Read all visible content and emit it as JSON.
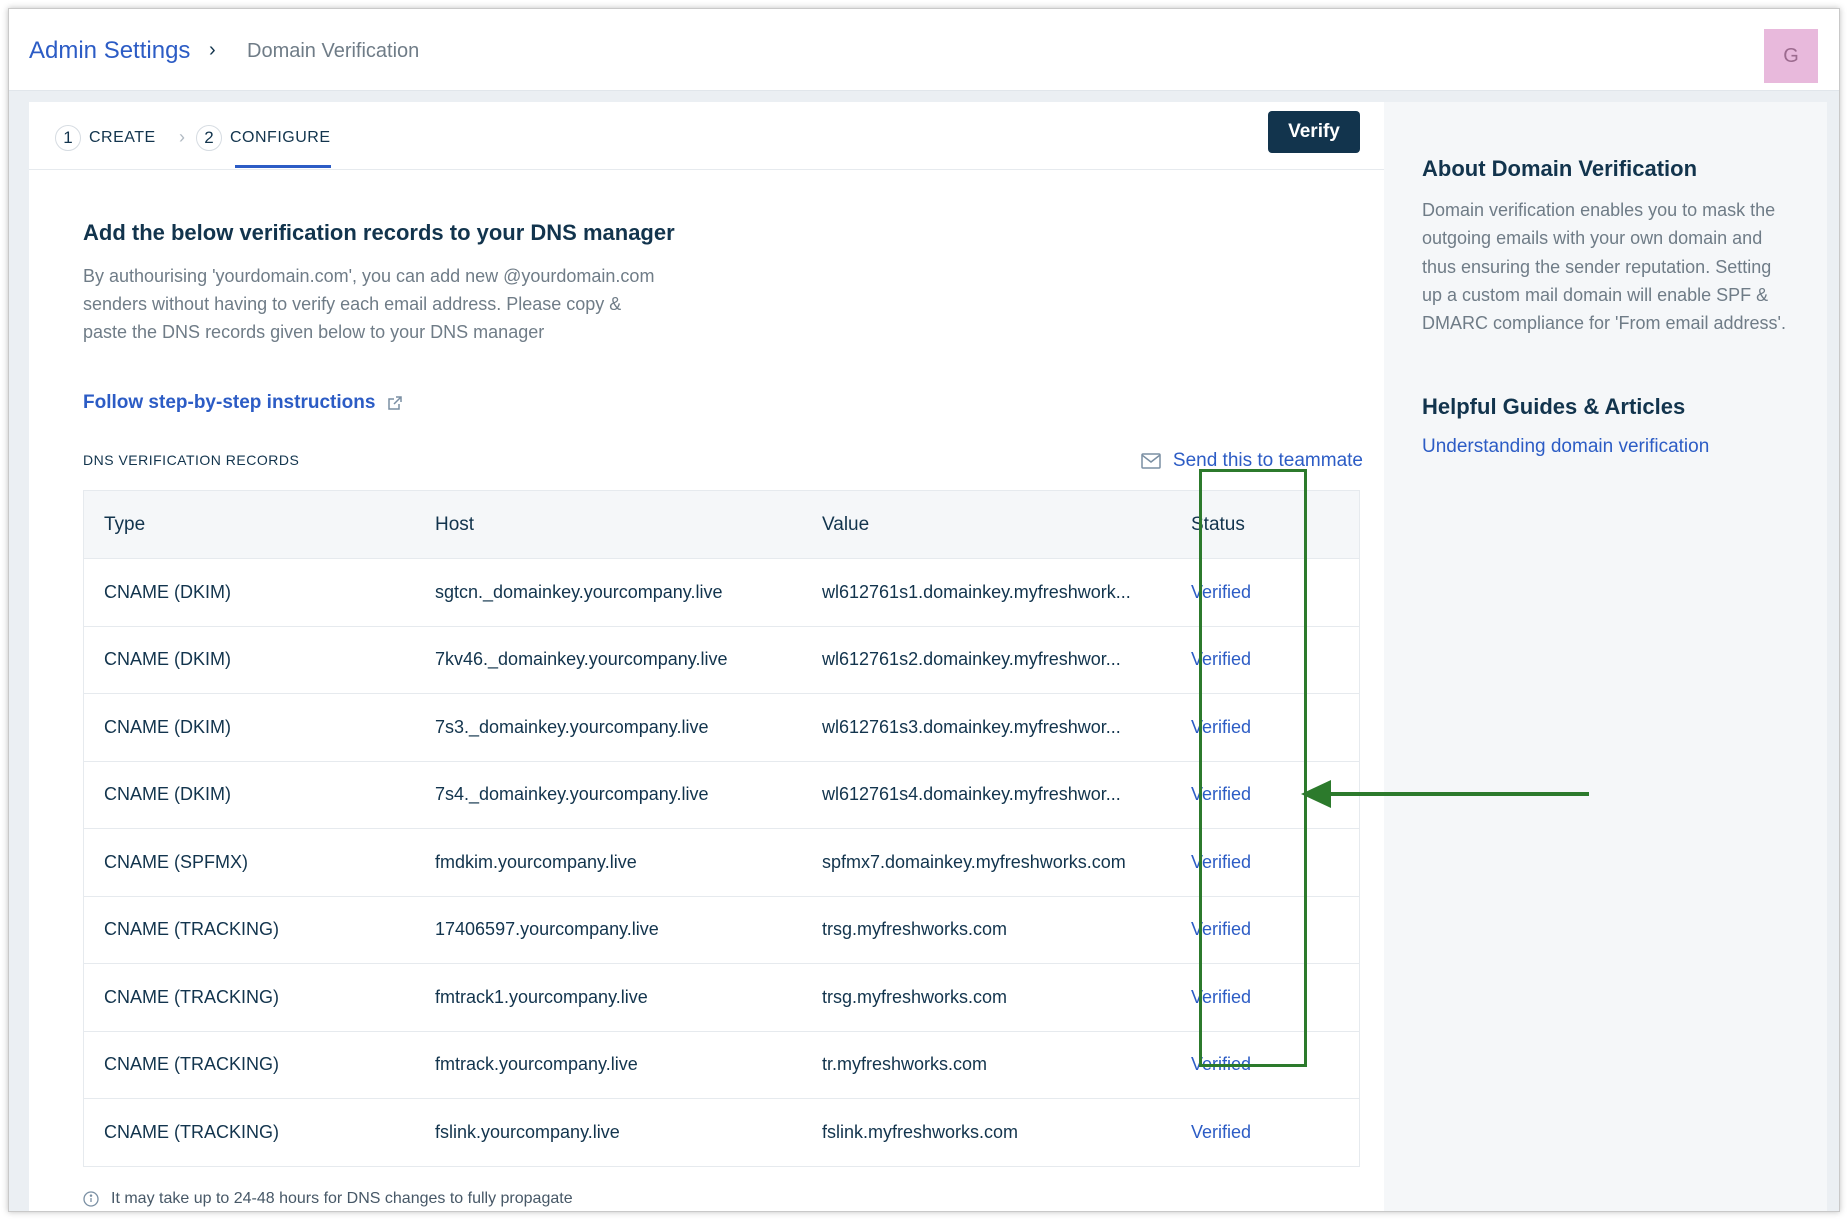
{
  "breadcrumb": {
    "root": "Admin Settings",
    "separator": "›",
    "current": "Domain Verification"
  },
  "avatar": {
    "initial": "G",
    "color": "#e8b9dc"
  },
  "steps": [
    {
      "number": "1",
      "label": "CREATE"
    },
    {
      "number": "2",
      "label": "CONFIGURE",
      "active": true
    }
  ],
  "verify_button": "Verify",
  "content": {
    "heading": "Add the below verification records to your DNS manager",
    "description": "By authourising 'yourdomain.com', you can add new @yourdomain.com senders without having to verify each email address. Please copy & paste the DNS records given below to your DNS manager",
    "follow_link": "Follow step-by-step instructions",
    "records_title": "DNS VERIFICATION RECORDS",
    "send_link": "Send this to teammate",
    "note": "It may take up to 24-48 hours for DNS changes to fully propagate"
  },
  "table": {
    "headers": {
      "type": "Type",
      "host": "Host",
      "value": "Value",
      "status": "Status"
    },
    "rows": [
      {
        "type": "CNAME (DKIM)",
        "host": "sgtcn._domainkey.yourcompany.live",
        "value": "wl612761s1.domainkey.myfreshwork...",
        "status": "Verified"
      },
      {
        "type": "CNAME (DKIM)",
        "host": "7kv46._domainkey.yourcompany.live",
        "value": "wl612761s2.domainkey.myfreshwor...",
        "status": "Verified"
      },
      {
        "type": "CNAME (DKIM)",
        "host": "7s3._domainkey.yourcompany.live",
        "value": "wl612761s3.domainkey.myfreshwor...",
        "status": "Verified"
      },
      {
        "type": "CNAME (DKIM)",
        "host": "7s4._domainkey.yourcompany.live",
        "value": "wl612761s4.domainkey.myfreshwor...",
        "status": "Verified"
      },
      {
        "type": "CNAME (SPFMX)",
        "host": "fmdkim.yourcompany.live",
        "value": "spfmx7.domainkey.myfreshworks.com",
        "status": "Verified"
      },
      {
        "type": "CNAME (TRACKING)",
        "host": "17406597.yourcompany.live",
        "value": "trsg.myfreshworks.com",
        "status": "Verified"
      },
      {
        "type": "CNAME (TRACKING)",
        "host": "fmtrack1.yourcompany.live",
        "value": "trsg.myfreshworks.com",
        "status": "Verified"
      },
      {
        "type": "CNAME (TRACKING)",
        "host": "fmtrack.yourcompany.live",
        "value": "tr.myfreshworks.com",
        "status": "Verified"
      },
      {
        "type": "CNAME (TRACKING)",
        "host": "fslink.yourcompany.live",
        "value": "fslink.myfreshworks.com",
        "status": "Verified"
      }
    ]
  },
  "sidebar": {
    "about_title": "About Domain Verification",
    "about_text": "Domain verification enables you to mask the outgoing emails with your own domain and thus ensuring the sender reputation. Setting up a custom mail domain will enable SPF & DMARC compliance for 'From email address'.",
    "guides_title": "Helpful Guides & Articles",
    "guide_link": "Understanding domain verification"
  },
  "colors": {
    "link": "#2c5cc5",
    "primary_dark": "#12344d",
    "annotation": "#2c7a2c"
  }
}
